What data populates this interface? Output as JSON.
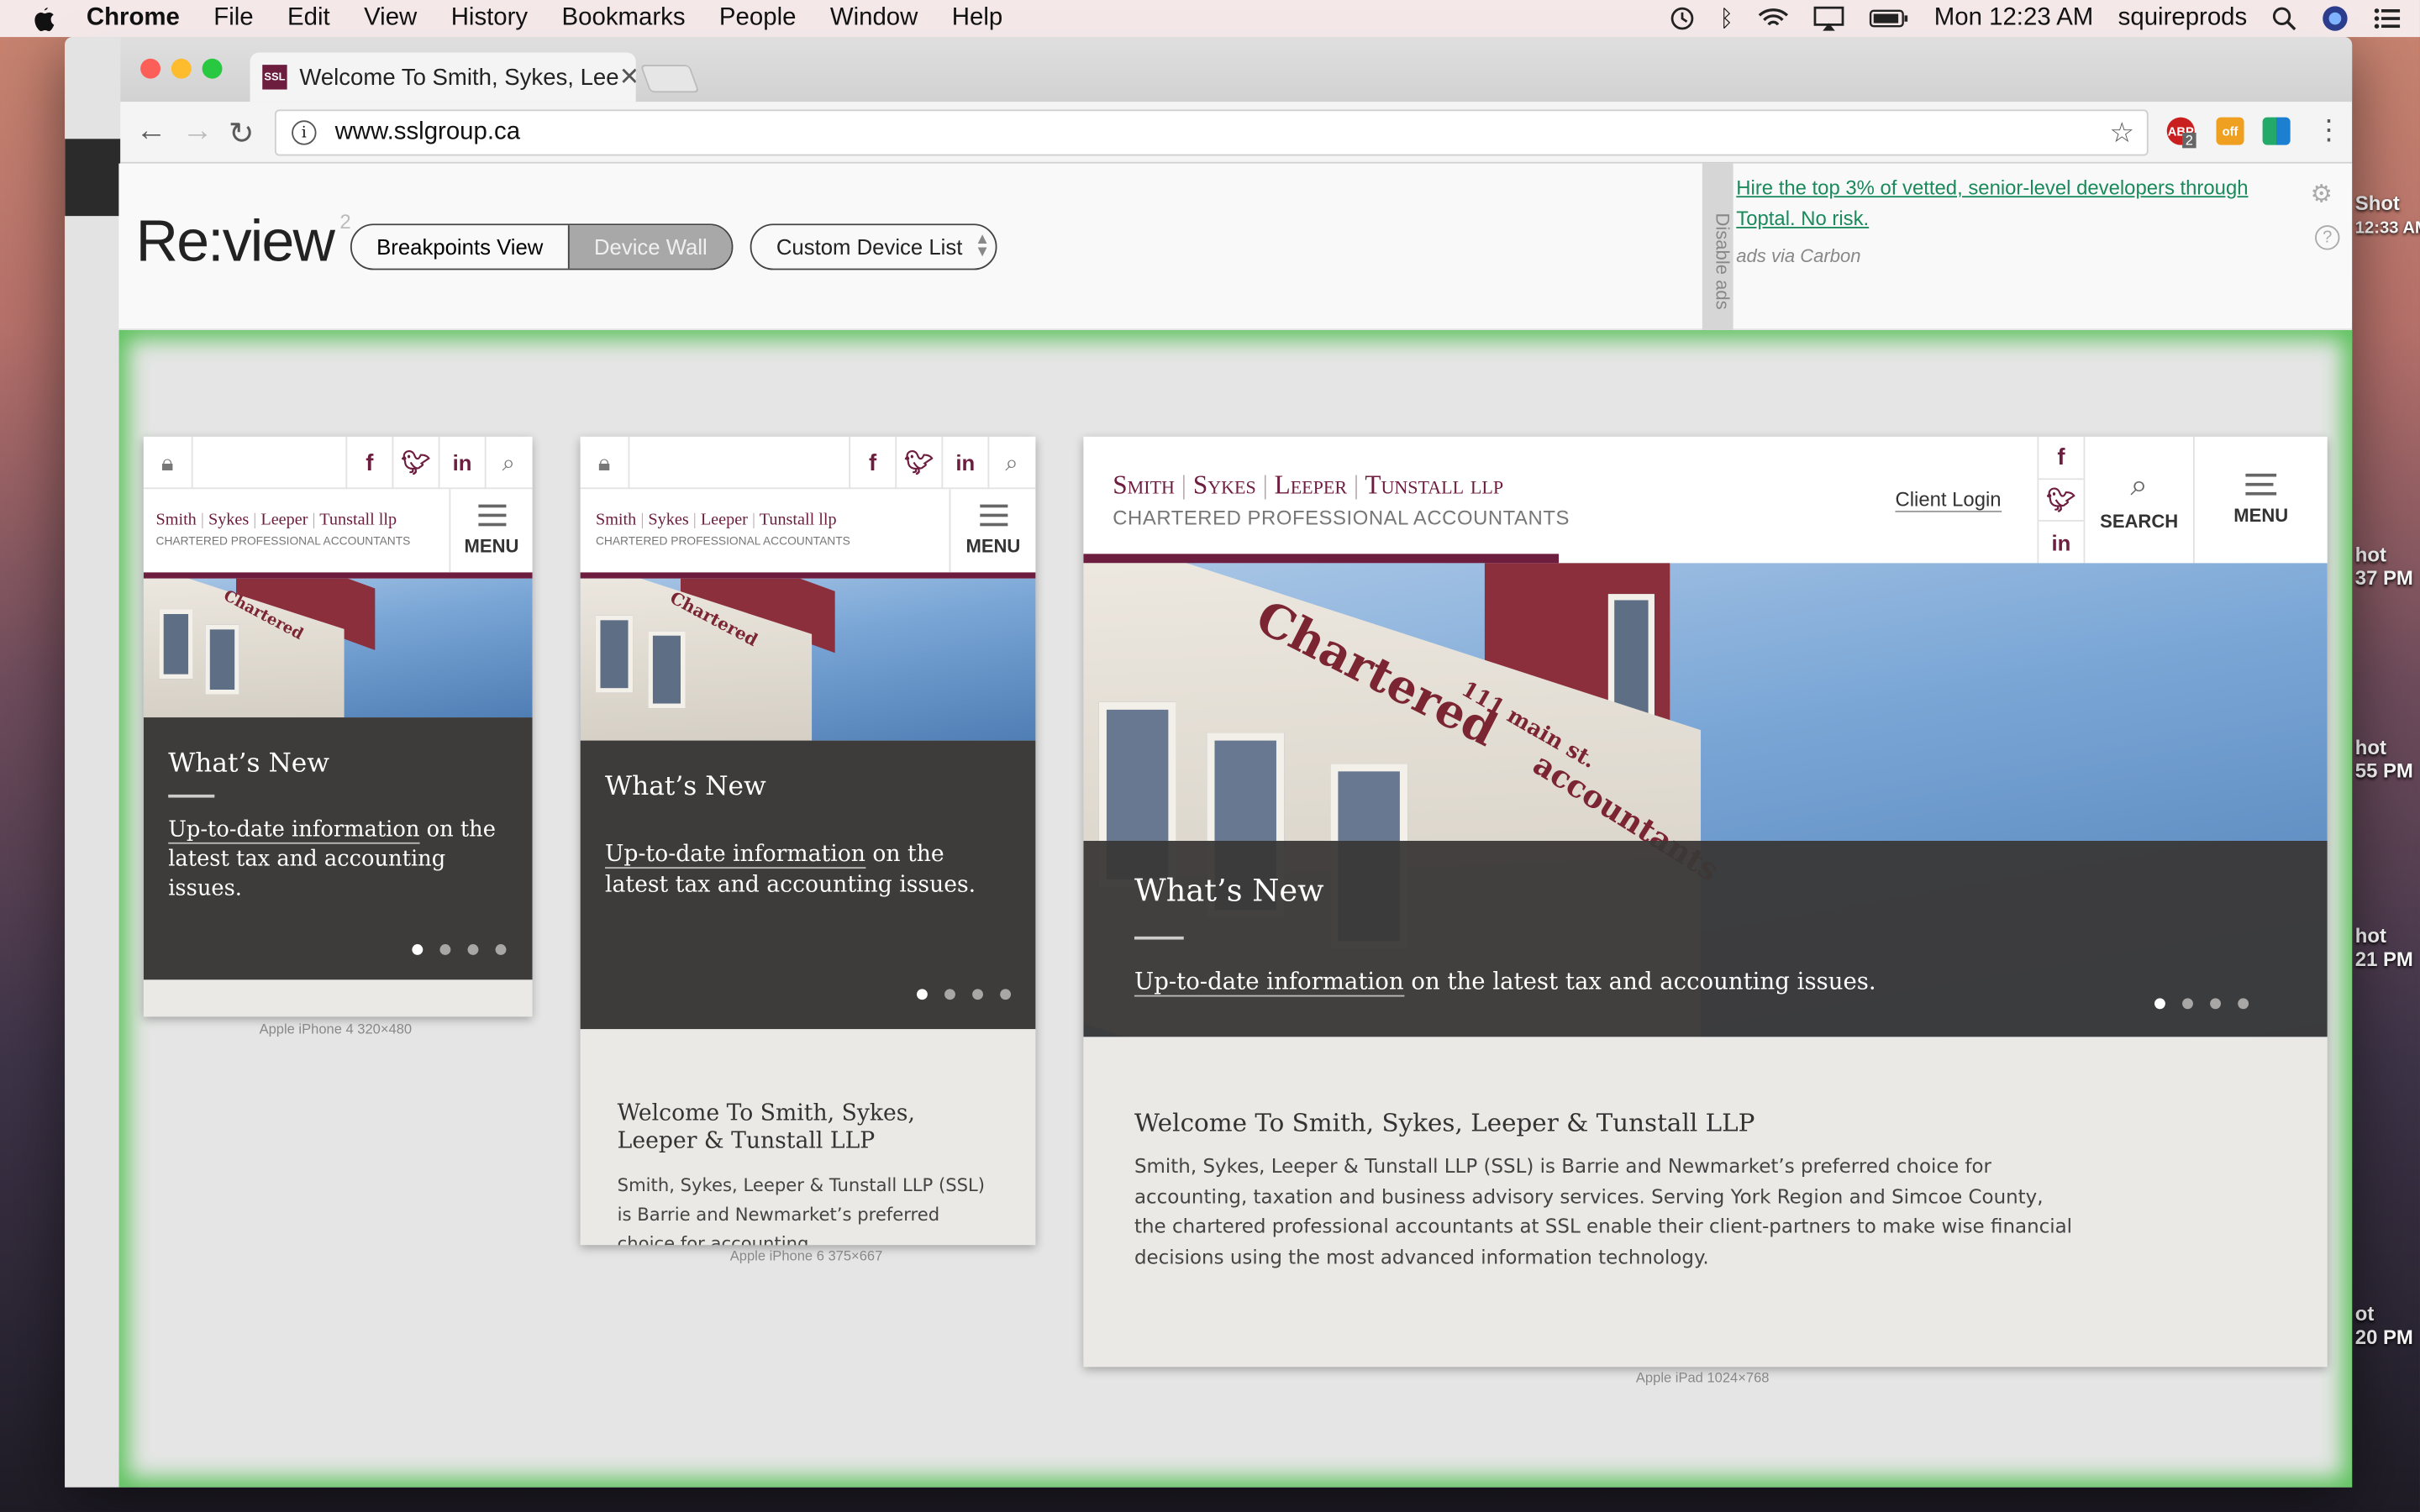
{
  "menubar": {
    "app": "Chrome",
    "items": [
      "File",
      "Edit",
      "View",
      "History",
      "Bookmarks",
      "People",
      "Window",
      "Help"
    ],
    "clock": "Mon 12:23 AM",
    "user": "squireprods"
  },
  "browser": {
    "tab_title": "Welcome To Smith, Sykes, Lee",
    "favicon_text": "SSL",
    "url": "www.sslgroup.ca",
    "ext_badge": "2",
    "ext_off": "off"
  },
  "review": {
    "logo": "Re:view",
    "logo_sup": "2",
    "breakpoints": "Breakpoints View",
    "device_wall": "Device Wall",
    "custom_list": "Custom Device List",
    "disable_ads": "Disable ads",
    "ad_text": "Hire the top 3% of vetted, senior-level developers through Toptal. No risk.",
    "ad_via": "ads via Carbon"
  },
  "site": {
    "brand1": "Smith",
    "brand2": "Sykes",
    "brand3": "Leeper",
    "brand4": "Tunstall llp",
    "brand_sub": "CHARTERED PROFESSIONAL ACCOUNTANTS",
    "menu": "MENU",
    "search": "SEARCH",
    "client_login": "Client Login",
    "sign1": "Chartered",
    "sign2": "111 main st.",
    "sign3": "accountants",
    "news_title": "What’s New",
    "news_link": "Up-to-date information",
    "news_rest": " on the latest tax and accounting issues.",
    "welcome_title": "Welcome To Smith, Sykes, Leeper & Tunstall LLP",
    "welcome_body": "Smith, Sykes, Leeper & Tunstall LLP (SSL) is Barrie and Newmarket’s preferred choice for accounting, taxation and business advisory services. Serving York Region and Simcoe County, the chartered professional accountants at SSL enable their client-partners to make wise financial decisions using the most advanced information technology.",
    "iphone6_body": "Smith, Sykes, Leeper & Tunstall LLP (SSL) is Barrie and Newmarket’s preferred choice for accounting"
  },
  "devices": {
    "iphone4": "Apple iPhone 4   320×480",
    "iphone6": "Apple iPhone 6   375×667",
    "ipad": "Apple iPad   1024×768"
  },
  "desktop": {
    "f1": "Shot",
    "f1b": "12:33 AM",
    "f2": "hot",
    "f2b": "37 PM",
    "f3": "hot",
    "f3b": "55 PM",
    "f4": "hot",
    "f4b": "21 PM",
    "f5": "ot",
    "f5b": "20 PM"
  },
  "colors": {
    "brand": "#6d1d3e",
    "ad_link": "#1a8a5c",
    "wall_glow": "#5fc35f"
  }
}
